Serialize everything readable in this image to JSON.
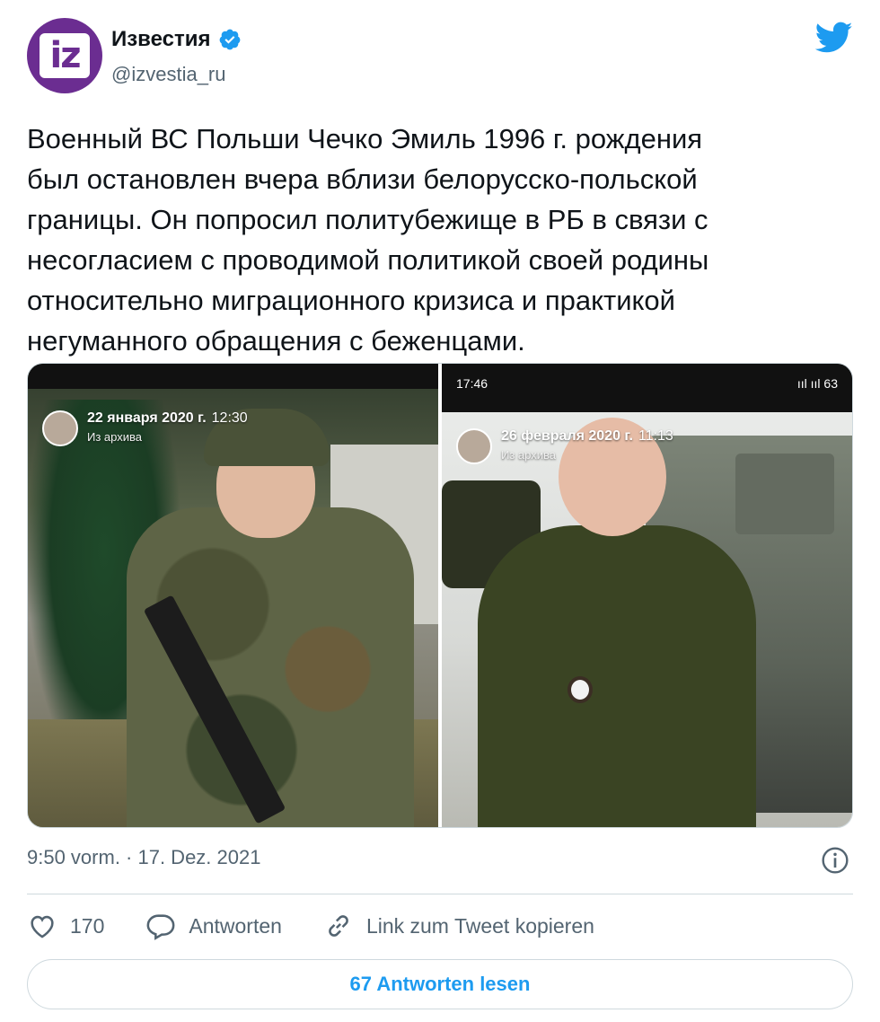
{
  "author": {
    "display_name": "Известия",
    "handle": "@izvestia_ru",
    "avatar_text": "iz",
    "verified": true
  },
  "tweet": {
    "text": "Военный ВС Польши Чечко Эмиль 1996 г. рождения\nбыл остановлен вчера вблизи белорусско-польской\nграницы. Он попросил политубежище в РБ в связи с\nнесогласием с проводимой политикой своей родины\nотносительно миграционного кризиса и практикой\nнегуманного обращения с беженцами.",
    "timestamp": "9:50 vorm. · 17. Dez. 2021"
  },
  "media": {
    "left": {
      "story_date": "22 января 2020 г.",
      "story_time": "12:30",
      "story_sub": "Из архива"
    },
    "right": {
      "status_time": "17:46",
      "status_right": "ııl ııl 63",
      "story_date": "26 февраля 2020 г.",
      "story_time": "11:13",
      "story_sub": "Из архива"
    }
  },
  "actions": {
    "likes_count": "170",
    "reply_label": "Antworten",
    "copy_link_label": "Link zum Tweet kopieren"
  },
  "read_replies_label": "67 Antworten lesen",
  "colors": {
    "accent": "#1d9bf0",
    "brand_purple": "#6b2d91",
    "text_secondary": "#536471"
  },
  "icons": {
    "twitter": "twitter-bird-icon",
    "verified": "verified-badge-icon",
    "like": "heart-icon",
    "reply": "reply-bubble-icon",
    "copy_link": "link-icon",
    "info": "info-icon"
  }
}
